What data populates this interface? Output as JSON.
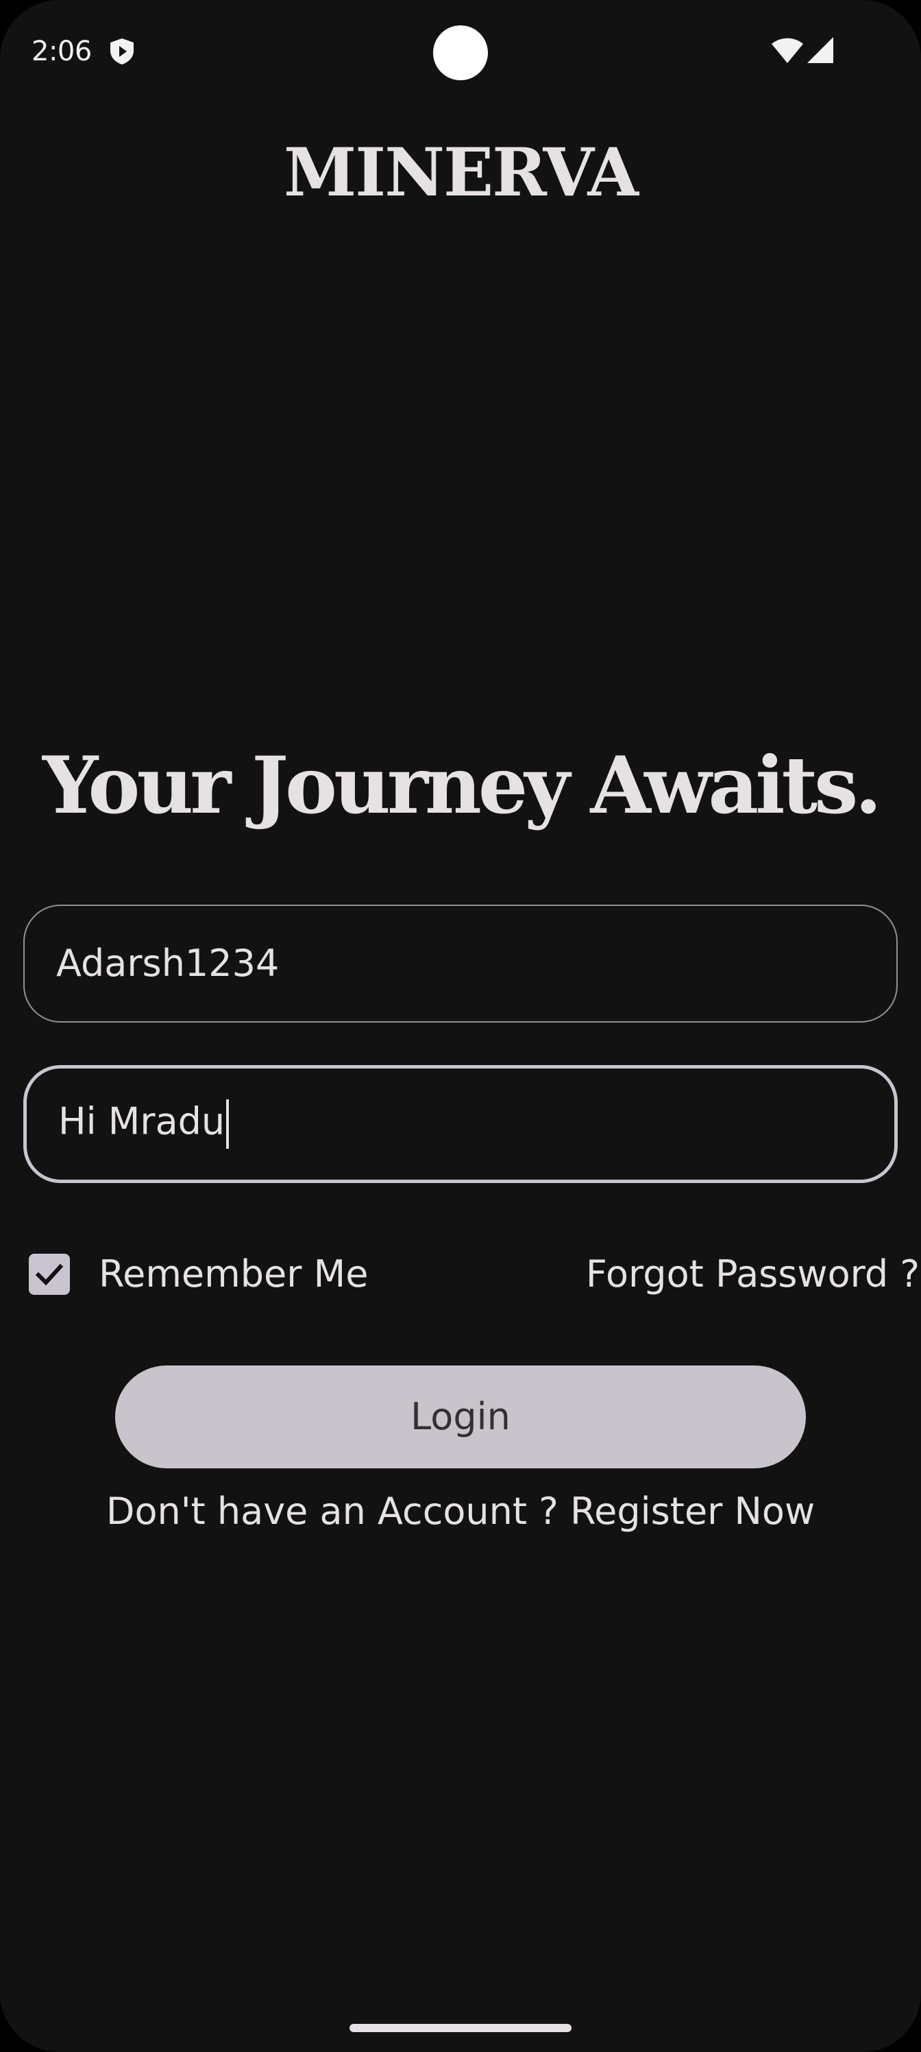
{
  "status_bar": {
    "time": "2:06",
    "shield_icon": "shield-play-icon",
    "wifi_icon": "wifi-icon",
    "signal_icon": "cell-signal-icon"
  },
  "brand": {
    "name": "MINERVA"
  },
  "headline": "Your Journey Awaits.",
  "form": {
    "username_value": "Adarsh1234",
    "password_value": "Hi Mradu",
    "remember_me": {
      "label": "Remember Me",
      "checked": true
    },
    "forgot_password": "Forgot Password ?",
    "login_label": "Login",
    "register_prompt": "Don't have an Account ? Register Now"
  },
  "colors": {
    "background": "#121212",
    "text": "#e6e1e5",
    "button": "#c9c4cb",
    "button_text": "#322f35",
    "outline": "#938f99",
    "focused_outline": "#cac4d0"
  }
}
